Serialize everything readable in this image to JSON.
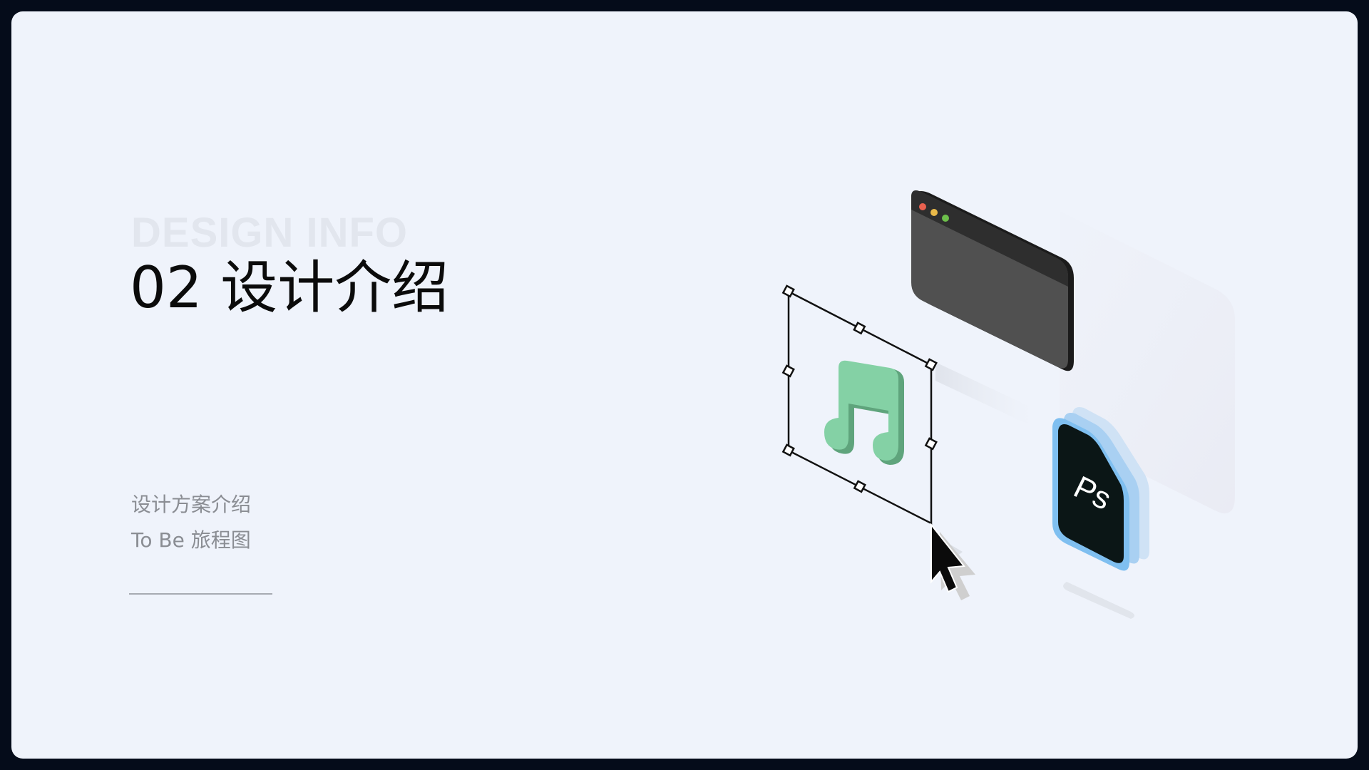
{
  "slide": {
    "ghost_title": "DESIGN INFO",
    "title": "02 设计介绍",
    "subtitle_line1": "设计方案介绍",
    "subtitle_line2": "To Be 旅程图"
  },
  "illustration": {
    "ps_badge_text": "Ps",
    "icons": [
      "browser-window-icon",
      "music-note-icon",
      "selection-box-icon",
      "cursor-arrow-icon",
      "photoshop-file-icon"
    ],
    "colors": {
      "background": "#eff3fb",
      "frame": "#050c1a",
      "music_note": "#84d1a5",
      "browser_body": "#505050",
      "ps_file": "#0b1616",
      "ps_border": "#7fbff0",
      "traffic_red": "#e9614f",
      "traffic_yellow": "#e9b949",
      "traffic_green": "#6dbf4b"
    }
  }
}
